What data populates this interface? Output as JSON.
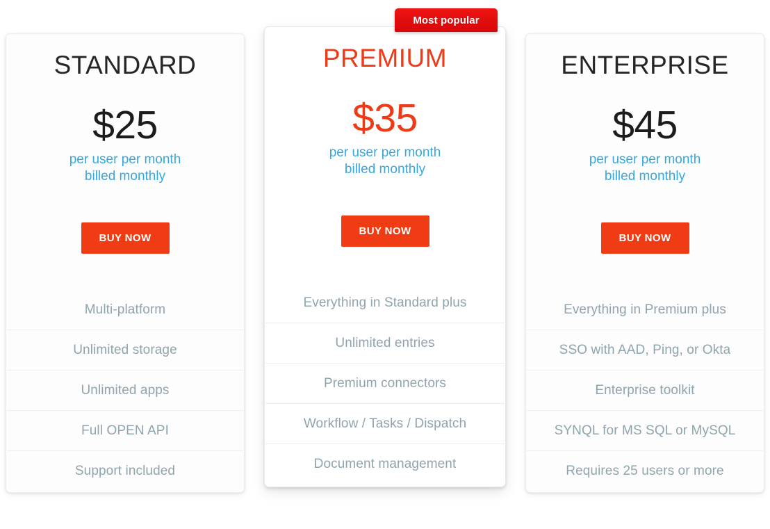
{
  "badge": {
    "label": "Most popular",
    "color": "#e50f0f"
  },
  "theme": {
    "accent": "#ef3a17",
    "button": "#f03c14",
    "note_color": "#35a8e0",
    "feature_color": "#8fa4ad"
  },
  "plans": [
    {
      "name": "STANDARD",
      "price": "$25",
      "note_line1": "per user per month",
      "note_line2": "billed monthly",
      "cta": "BUY NOW",
      "featured": false,
      "features": [
        "Multi-platform",
        "Unlimited storage",
        "Unlimited apps",
        "Full OPEN API",
        "Support included"
      ]
    },
    {
      "name": "PREMIUM",
      "price": "$35",
      "note_line1": "per user per month",
      "note_line2": "billed monthly",
      "cta": "BUY NOW",
      "featured": true,
      "features": [
        "Everything in Standard plus",
        "Unlimited entries",
        "Premium connectors",
        "Workflow / Tasks / Dispatch",
        "Document management"
      ]
    },
    {
      "name": "ENTERPRISE",
      "price": "$45",
      "note_line1": "per user per month",
      "note_line2": "billed monthly",
      "cta": "BUY NOW",
      "featured": false,
      "features": [
        "Everything in Premium plus",
        "SSO with AAD, Ping, or Okta",
        "Enterprise toolkit",
        "SYNQL for MS SQL or MySQL",
        "Requires 25 users or more"
      ]
    }
  ]
}
